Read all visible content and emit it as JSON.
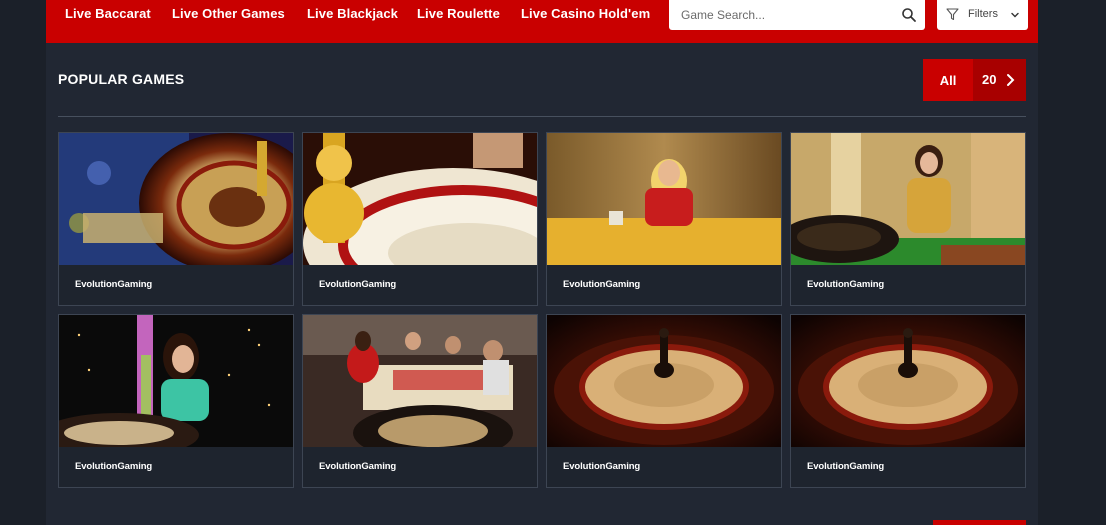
{
  "nav": {
    "links": [
      "Live Baccarat",
      "Live Other Games",
      "Live Blackjack",
      "Live Roulette",
      "Live Casino Hold'em"
    ],
    "search_placeholder": "Game Search...",
    "filters_label": "Filters"
  },
  "section": {
    "title": "POPULAR GAMES",
    "all_label": "All",
    "count": "20"
  },
  "games": [
    {
      "provider": "EvolutionGaming",
      "thumb": "roulette-wheel-chips"
    },
    {
      "provider": "EvolutionGaming",
      "thumb": "roulette-wheel-closeup"
    },
    {
      "provider": "EvolutionGaming",
      "thumb": "dealer-blonde-baccarat"
    },
    {
      "provider": "EvolutionGaming",
      "thumb": "dealer-gold-roulette"
    },
    {
      "provider": "EvolutionGaming",
      "thumb": "dealer-neon-roulette"
    },
    {
      "provider": "EvolutionGaming",
      "thumb": "players-table-roulette"
    },
    {
      "provider": "EvolutionGaming",
      "thumb": "roulette-wheel-dark"
    },
    {
      "provider": "EvolutionGaming",
      "thumb": "roulette-wheel-dark"
    }
  ],
  "colors": {
    "brand_red": "#c90000",
    "panel": "#212733",
    "page": "#1b2029"
  }
}
